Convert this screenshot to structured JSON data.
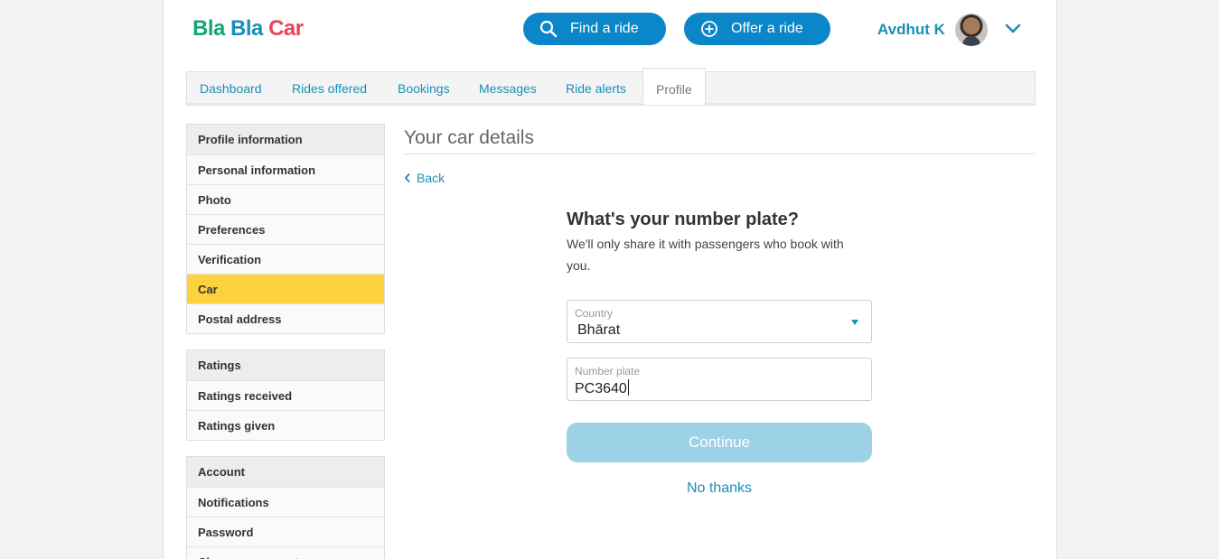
{
  "header": {
    "logo": {
      "part1": "Bla",
      "part2": "Bla",
      "part3": "Car"
    },
    "find_ride": "Find a ride",
    "offer_ride": "Offer a ride",
    "user_name": "Avdhut K"
  },
  "tabs": [
    {
      "label": "Dashboard"
    },
    {
      "label": "Rides offered"
    },
    {
      "label": "Bookings"
    },
    {
      "label": "Messages"
    },
    {
      "label": "Ride alerts"
    },
    {
      "label": "Profile",
      "active": true
    }
  ],
  "sidebar": {
    "profile": [
      "Profile information",
      "Personal information",
      "Photo",
      "Preferences",
      "Verification",
      "Car",
      "Postal address"
    ],
    "ratings": [
      "Ratings",
      "Ratings received",
      "Ratings given"
    ],
    "account": [
      "Account",
      "Notifications",
      "Password",
      "Close my account"
    ]
  },
  "main": {
    "title": "Your car details",
    "back": "Back",
    "question": "What's your number plate?",
    "subtitle": "We'll only share it with passengers who book with you.",
    "country_label": "Country",
    "country_value": "Bhārat",
    "plate_label": "Number plate",
    "plate_value": "PC3640",
    "continue": "Continue",
    "no_thanks": "No thanks"
  },
  "colors": {
    "brand_blue": "#0b86c8",
    "link_blue": "#1a8fb8",
    "active_yellow": "#fdd23f",
    "disabled_button": "#9dd1e6"
  }
}
